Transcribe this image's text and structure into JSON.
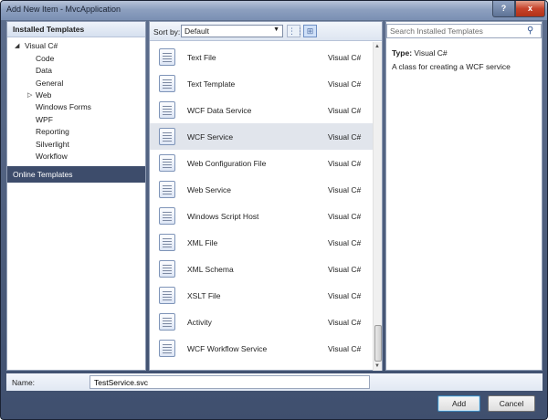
{
  "window": {
    "title": "Add New Item - MvcApplication",
    "help": "?",
    "close": "x"
  },
  "left_pane": {
    "header": "Installed Templates",
    "root": "Visual C#",
    "items": [
      "Code",
      "Data",
      "General",
      "Web",
      "Windows Forms",
      "WPF",
      "Reporting",
      "Silverlight",
      "Workflow"
    ],
    "online": "Online Templates"
  },
  "toolbar": {
    "sort_label": "Sort by:",
    "sort_value": "Default",
    "view_small": "⋮⋮",
    "view_large": "⊞"
  },
  "templates": [
    {
      "name": "Text File",
      "lang": "Visual C#"
    },
    {
      "name": "Text Template",
      "lang": "Visual C#"
    },
    {
      "name": "WCF Data Service",
      "lang": "Visual C#"
    },
    {
      "name": "WCF Service",
      "lang": "Visual C#",
      "selected": true
    },
    {
      "name": "Web Configuration File",
      "lang": "Visual C#"
    },
    {
      "name": "Web Service",
      "lang": "Visual C#"
    },
    {
      "name": "Windows Script Host",
      "lang": "Visual C#"
    },
    {
      "name": "XML File",
      "lang": "Visual C#"
    },
    {
      "name": "XML Schema",
      "lang": "Visual C#"
    },
    {
      "name": "XSLT File",
      "lang": "Visual C#"
    },
    {
      "name": "Activity",
      "lang": "Visual C#"
    },
    {
      "name": "WCF Workflow Service",
      "lang": "Visual C#"
    }
  ],
  "right_pane": {
    "search_placeholder": "Search Installed Templates",
    "type_label": "Type:",
    "type_value": "Visual C#",
    "description": "A class for creating a WCF service"
  },
  "footer": {
    "name_label": "Name:",
    "name_value": "TestService.svc",
    "add": "Add",
    "cancel": "Cancel"
  }
}
